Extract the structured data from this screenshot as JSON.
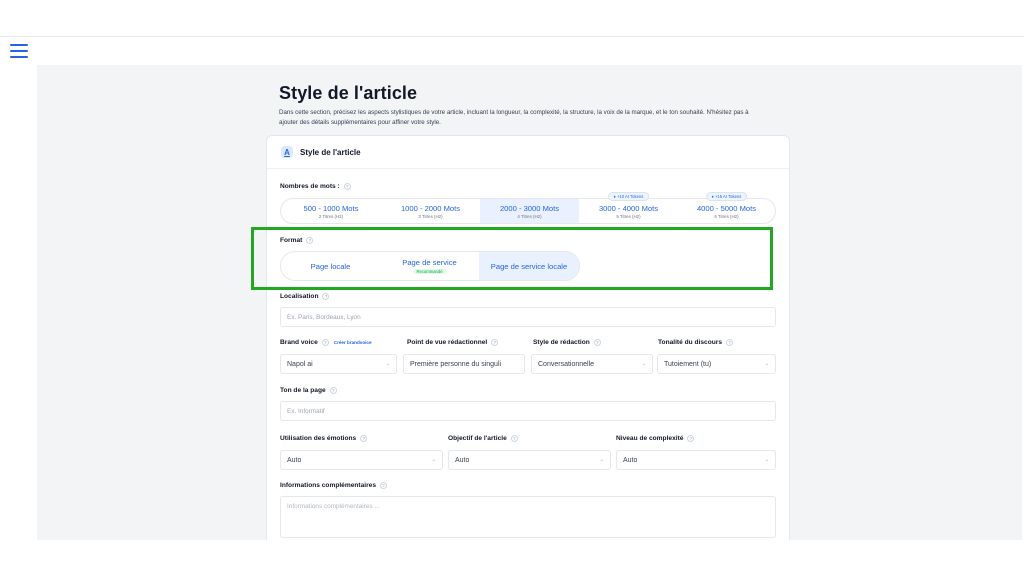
{
  "header": {
    "menu_icon": "hamburger-icon"
  },
  "section": {
    "title": "Style de l'article",
    "description": "Dans cette section, précisez les aspects stylistiques de votre article, incluant la longueur, la complexité, la structure, la voix de la marque, et le ton souhaité. N'hésitez pas à ajouter des détails supplémentaires pour affiner votre style."
  },
  "card": {
    "title": "Style de l'article",
    "icon": "text-style-icon"
  },
  "word_count": {
    "label": "Nombres de mots :",
    "options": [
      {
        "main": "500 - 1000 Mots",
        "sub": "2 Titres (H2)",
        "badge": ""
      },
      {
        "main": "1000 - 2000 Mots",
        "sub": "3 Titres (H2)",
        "badge": ""
      },
      {
        "main": "2000 - 3000 Mots",
        "sub": "4 Titres (H2)",
        "badge": "",
        "active": true
      },
      {
        "main": "3000 - 4000 Mots",
        "sub": "5 Titres (H2)",
        "badge": "+10 AI Tokens"
      },
      {
        "main": "4000 - 5000 Mots",
        "sub": "6 Titres (H2)",
        "badge": "+15 AI Tokens"
      }
    ]
  },
  "format": {
    "label": "Format",
    "options": [
      {
        "main": "Page locale",
        "reco": ""
      },
      {
        "main": "Page de service",
        "reco": "Recommandé"
      },
      {
        "main": "Page de service locale",
        "reco": "",
        "active": true
      }
    ]
  },
  "localisation": {
    "label": "Localisation",
    "placeholder": "Ex. Paris, Bordeaux, Lyon"
  },
  "brand_voice": {
    "label": "Brand voice",
    "link": "Créer brandvoice",
    "value": "Napol ai"
  },
  "point_of_view": {
    "label": "Point de vue rédactionnel",
    "value": "Première personne du singuli"
  },
  "writing_style": {
    "label": "Style de rédaction",
    "value": "Conversationnelle"
  },
  "tone_of_speech": {
    "label": "Tonalité du discours",
    "value": "Tutoiement (tu)"
  },
  "page_tone": {
    "label": "Ton de la page",
    "placeholder": "Ex. Informatif"
  },
  "emotions": {
    "label": "Utilisation des émotions",
    "value": "Auto"
  },
  "objective": {
    "label": "Objectif de l'article",
    "value": "Auto"
  },
  "complexity": {
    "label": "Niveau de complexité",
    "value": "Auto"
  },
  "extra_info": {
    "label": "Informations complémentaires",
    "placeholder": "Informations complémentaires ..."
  },
  "colors": {
    "accent": "#2563eb",
    "highlight": "#22a722",
    "active_bg": "#e8f1fd"
  }
}
